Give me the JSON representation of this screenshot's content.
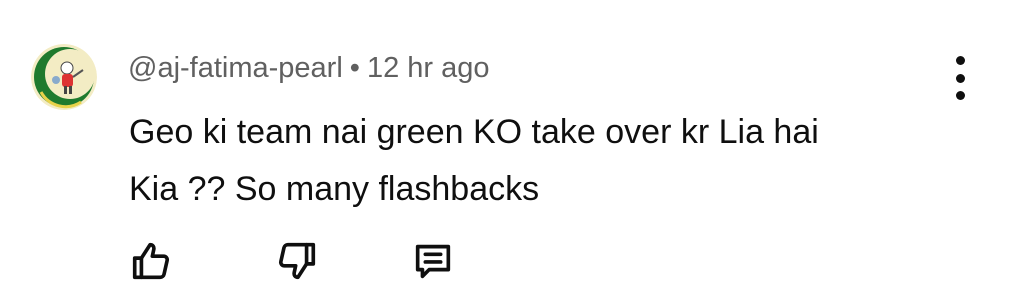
{
  "comment": {
    "author": "@aj-fatima-pearl",
    "separator": "•",
    "timestamp": "12 hr ago",
    "text_line_1": "Geo ki team nai green KO take over kr Lia hai",
    "text_line_2": "Kia ?? So many flashbacks"
  },
  "actions": {
    "like_icon": "thumbs-up-icon",
    "dislike_icon": "thumbs-down-icon",
    "reply_icon": "comment-reply-icon",
    "menu_icon": "more-vertical-icon"
  },
  "colors": {
    "text_primary": "#0f0f0f",
    "text_secondary": "#606060",
    "avatar_green": "#1f7a2e",
    "avatar_yellow": "#e8d24a"
  }
}
